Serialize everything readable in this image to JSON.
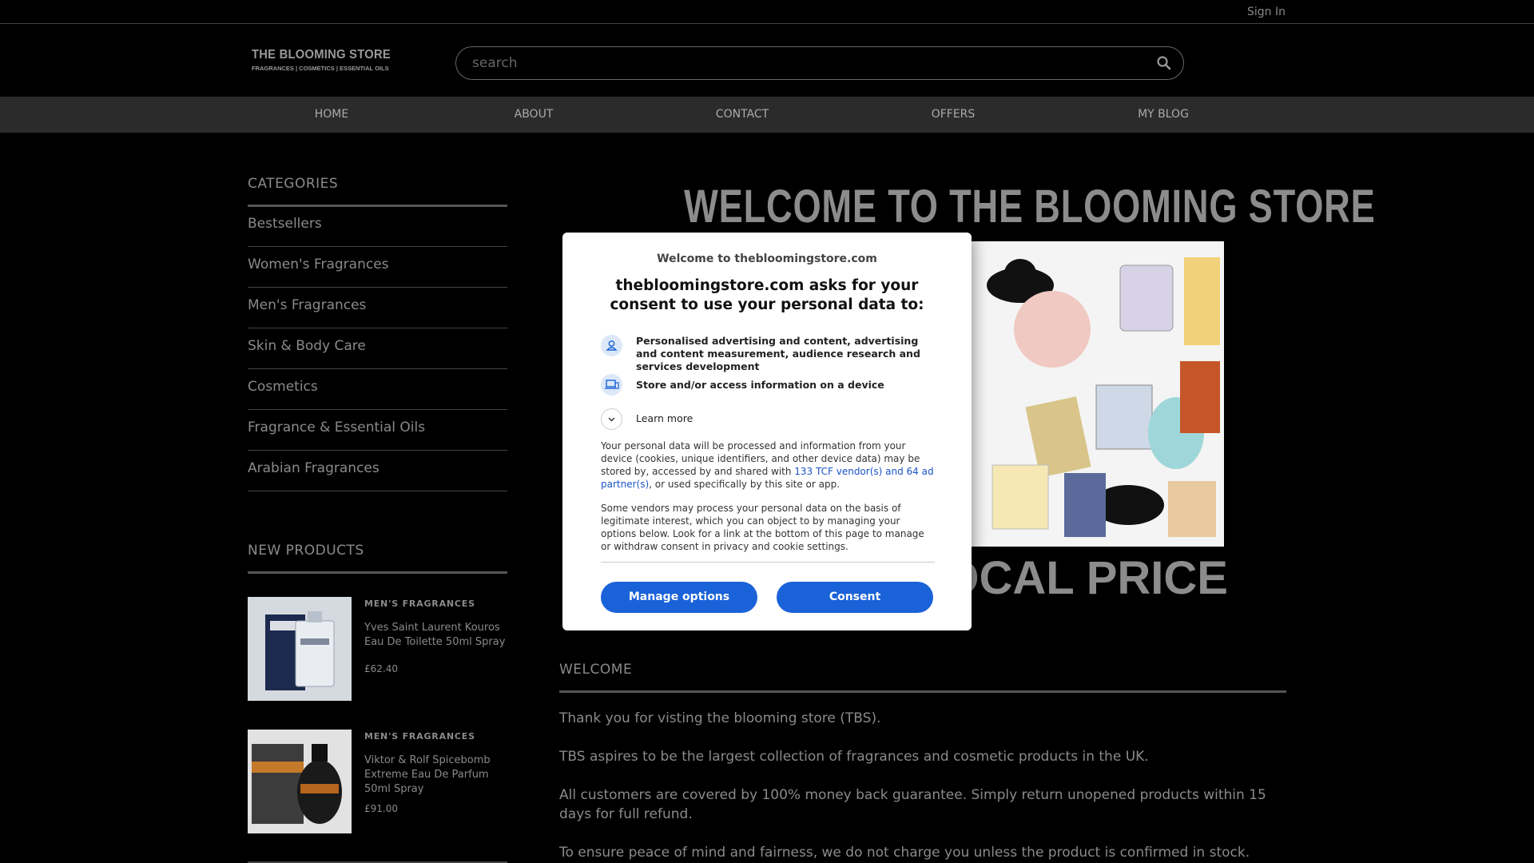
{
  "topbar": {
    "sign_in": "Sign In"
  },
  "header": {
    "logo_title": "THE BLOOMING STORE",
    "logo_tagline": "FRAGRANCES | COSMETICS | ESSENTIAL OILS",
    "search_placeholder": "search"
  },
  "nav": {
    "items": [
      "HOME",
      "ABOUT",
      "CONTACT",
      "OFFERS",
      "MY BLOG"
    ]
  },
  "sidebar": {
    "categories_heading": "CATEGORIES",
    "categories": [
      "Bestsellers",
      "Women's Fragrances",
      "Men's Fragrances",
      "Skin & Body Care",
      "Cosmetics",
      "Fragrance & Essential Oils",
      "Arabian Fragrances"
    ],
    "new_products_heading": "NEW PRODUCTS",
    "products": [
      {
        "category": "MEN'S FRAGRANCES",
        "name": "Yves Saint Laurent Kouros Eau De Toilette 50ml Spray",
        "price": "£62.40",
        "icon": "kouros-bottle-image"
      },
      {
        "category": "MEN'S FRAGRANCES",
        "name": "Viktor & Rolf Spicebomb Extreme Eau De Parfum 50ml Spray",
        "price": "£91.00",
        "icon": "spicebomb-bottle-image"
      }
    ]
  },
  "hero": {
    "title": "WELCOME TO THE BLOOMING STORE",
    "subtitle": "AT LOCAL PRICE",
    "image_icon": "perfume-bottles-collage"
  },
  "welcome": {
    "heading": "WELCOME",
    "paragraphs": [
      "Thank you for visting the blooming store (TBS).",
      "TBS aspires to be the largest collection of fragrances and cosmetic products in the UK.",
      "All customers are covered by 100% money back guarantee. Simply return unopened products within 15 days for full refund.",
      "To ensure peace of mind and fairness, we do not charge you unless the product is confirmed in stock."
    ]
  },
  "consent": {
    "welcome": "Welcome to thebloomingstore.com",
    "title": "thebloomingstore.com asks for your consent to use your personal data to:",
    "purposes": [
      {
        "icon": "person-icon",
        "text": "Personalised advertising and content, advertising and content measurement, audience research and services development"
      },
      {
        "icon": "devices-icon",
        "text": "Store and/or access information on a device"
      }
    ],
    "learn_more": "Learn more",
    "body_before_link": "Your personal data will be processed and information from your device (cookies, unique identifiers, and other device data) may be stored by, accessed by and shared with ",
    "partners_link": "133 TCF vendor(s) and 64 ad partner(s)",
    "body_after_link": ", or used specifically by this site or app.",
    "legitimate_interest": "Some vendors may process your personal data on the basis of legitimate interest, which you can object to by managing your options below. Look for a link at the bottom of this page to manage or withdraw consent in privacy and cookie settings.",
    "manage_button": "Manage options",
    "consent_button": "Consent"
  },
  "colors": {
    "background": "#000000",
    "nav_bar": "#2b2b2b",
    "text": "#8a8a8a",
    "button_blue": "#1a62d8",
    "link_blue": "#1a53c7"
  }
}
